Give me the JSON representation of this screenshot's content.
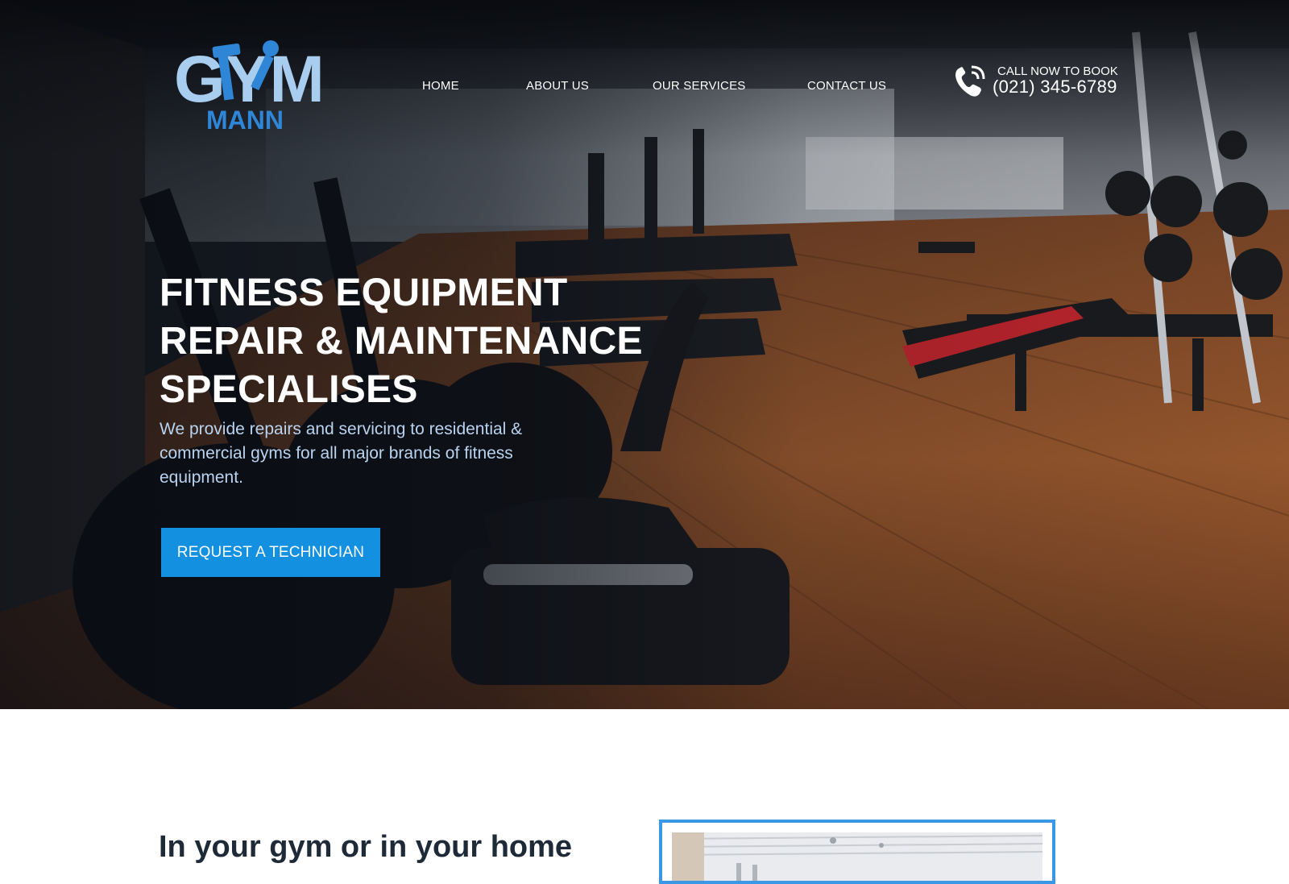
{
  "brand": {
    "logo_top": "GYM",
    "logo_bottom": "MANN",
    "colors": {
      "logo_light": "#a9cdee",
      "logo_blue": "#2f86d6",
      "accent": "#1390e0"
    }
  },
  "nav": {
    "items": [
      {
        "label": "HOME"
      },
      {
        "label": "ABOUT US"
      },
      {
        "label": "OUR SERVICES"
      },
      {
        "label": "CONTACT US"
      }
    ]
  },
  "call": {
    "label": "CALL NOW TO BOOK",
    "phone": "(021) 345-6789",
    "icon": "phone-icon"
  },
  "hero": {
    "title_lines": [
      "FITNESS EQUIPMENT",
      "REPAIR & MAINTENANCE",
      "SPECIALISES"
    ],
    "description": "We provide repairs and servicing to residential & commercial gyms for all major brands of fitness equipment.",
    "cta_label": "REQUEST A TECHNICIAN"
  },
  "intro": {
    "heading": "In your gym or in your home"
  }
}
